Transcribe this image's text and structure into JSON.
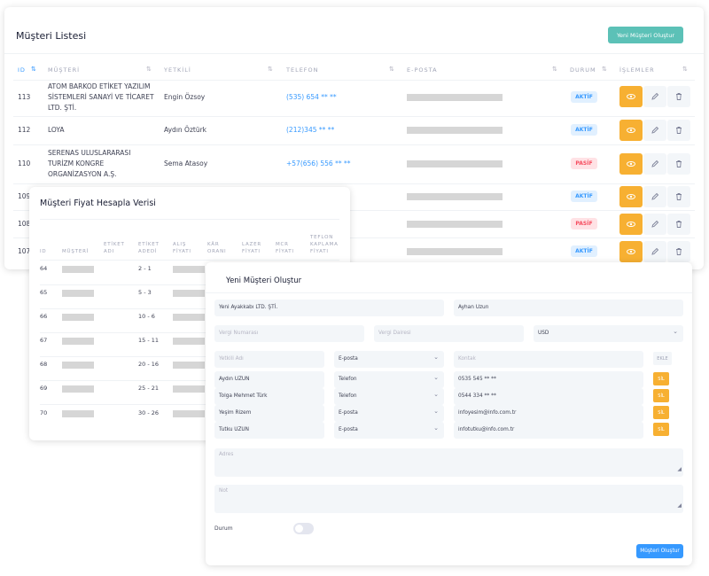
{
  "customer_list": {
    "title": "Müşteri Listesi",
    "create_button": "Yeni Müşteri Oluştur",
    "columns": [
      "ID",
      "MÜŞTERİ",
      "YETKİLİ",
      "TELEFON",
      "E-POSTA",
      "DURUM",
      "İŞLEMLER"
    ],
    "rows": [
      {
        "id": "113",
        "company": "ATOM BARKOD ETİKET YAZILIM SİSTEMLERİ SANAYİ VE TİCARET LTD. ŞTİ.",
        "contact": "Engin Özsoy",
        "phone": "(535) 654 ** **",
        "status": "AKTİF"
      },
      {
        "id": "112",
        "company": "LOYA",
        "contact": "Aydın Öztürk",
        "phone": "(212)345 ** **",
        "status": "AKTİF"
      },
      {
        "id": "110",
        "company": "SERENAS ULUSLARARASI TURİZM KONGRE ORGANİZASYON A.Ş.",
        "contact": "Sema Atasoy",
        "phone": "+57(656) 556 ** **",
        "status": "PASİF"
      },
      {
        "id": "109",
        "status": "AKTİF"
      },
      {
        "id": "108",
        "status": "PASİF"
      },
      {
        "id": "107",
        "status": "AKTİF"
      }
    ]
  },
  "price_card": {
    "title": "Müşteri Fiyat Hesapla Verisi",
    "columns": [
      "ID",
      "MÜŞTERİ",
      "ETİKET ADI",
      "ETİKET ADEDİ",
      "ALIŞ FİYATI",
      "KÂR ORANI",
      "LAZER FİYATI",
      "MCR FİYATI",
      "TEFLON KAPLAMA FİYATI"
    ],
    "rows": [
      {
        "id": "64",
        "qty": "2 - 1"
      },
      {
        "id": "65",
        "qty": "5 - 3"
      },
      {
        "id": "66",
        "qty": "10 - 6"
      },
      {
        "id": "67",
        "qty": "15 - 11"
      },
      {
        "id": "68",
        "qty": "20 - 16"
      },
      {
        "id": "69",
        "qty": "25 - 21"
      },
      {
        "id": "70",
        "qty": "30 - 26"
      }
    ]
  },
  "form": {
    "title": "Yeni Müşteri Oluştur",
    "company_value": "Yeni Ayakkabı LTD. ŞTİ.",
    "contact_value": "Ayhan Uzun",
    "tax_number_placeholder": "Vergi Numarası",
    "tax_office_placeholder": "Vergi Dairesi",
    "currency_value": "USD",
    "authorized_name_placeholder": "Yetkili Adı",
    "contact_type_value": "E-posta",
    "contact_placeholder": "Kontak",
    "add_button": "EKLE",
    "contacts": [
      {
        "name": "Aydın UZUN",
        "type": "Telefon",
        "value": "0535 545 ** **"
      },
      {
        "name": "Tolga Mehmet Türk",
        "type": "Telefon",
        "value": "0544 334 ** **"
      },
      {
        "name": "Yeşim Rizem",
        "type": "E-posta",
        "value": "infoyesim@info.com.tr"
      },
      {
        "name": "Tutku UZUN",
        "type": "E-posta",
        "value": "infotutku@info.com.tr"
      }
    ],
    "delete_button": "SİL",
    "address_placeholder": "Adres",
    "note_placeholder": "Not",
    "status_label": "Durum",
    "submit_button": "Müşteri Oluştur"
  },
  "colors": {
    "accent_blue": "#3699ff",
    "teal_button": "#5cc1b7",
    "orange_action": "#f7b032",
    "active_badge": "#3699ff",
    "passive_badge": "#f64e60"
  }
}
